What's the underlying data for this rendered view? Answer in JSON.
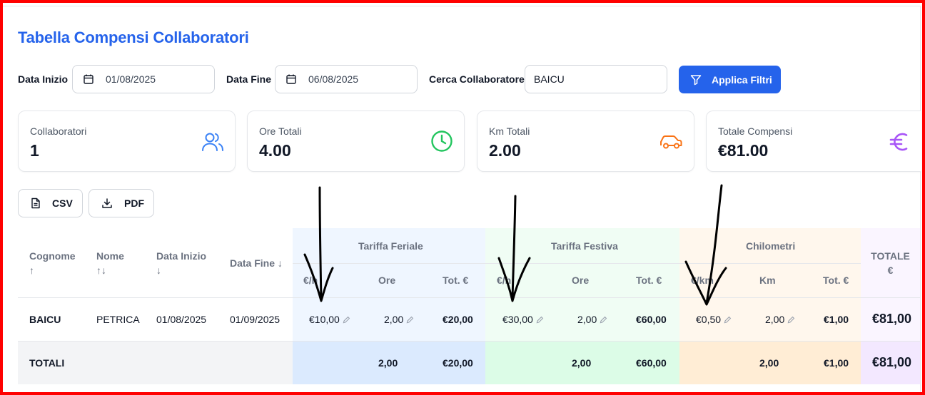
{
  "page": {
    "title": "Tabella Compensi Collaboratori"
  },
  "filters": {
    "start_label": "Data Inizio",
    "start_value": "01/08/2025",
    "end_label": "Data Fine",
    "end_value": "06/08/2025",
    "search_label": "Cerca Collaboratore",
    "search_value": "BAICU",
    "apply_label": "Applica Filtri"
  },
  "stats": [
    {
      "label": "Collaboratori",
      "value": "1",
      "icon": "users-icon",
      "color": "#3b82f6"
    },
    {
      "label": "Ore Totali",
      "value": "4.00",
      "icon": "clock-icon",
      "color": "#22c55e"
    },
    {
      "label": "Km Totali",
      "value": "2.00",
      "icon": "car-icon",
      "color": "#f97316"
    },
    {
      "label": "Totale Compensi",
      "value": "€81.00",
      "icon": "euro-icon",
      "color": "#a855f7"
    }
  ],
  "export": {
    "csv_label": "CSV",
    "pdf_label": "PDF"
  },
  "table": {
    "headers": {
      "cognome": "Cognome",
      "cognome_sort": "↑",
      "nome": "Nome",
      "nome_sort": "↑↓",
      "data_inizio": "Data Inizio",
      "data_inizio_sort": "↓",
      "data_fine": "Data Fine ↓",
      "group_feriale": "Tariffa Feriale",
      "group_festiva": "Tariffa Festiva",
      "group_km": "Chilometri",
      "totale": "TOTALE",
      "totale_unit": "€",
      "fer_rate": "€/h",
      "fer_ore": "Ore",
      "fer_tot": "Tot. €",
      "fes_rate": "€/h",
      "fes_ore": "Ore",
      "fes_tot": "Tot. €",
      "km_rate": "€/km",
      "km_km": "Km",
      "km_tot": "Tot. €"
    },
    "row": {
      "cognome": "BAICU",
      "nome": "PETRICA",
      "data_inizio": "01/08/2025",
      "data_fine": "01/09/2025",
      "fer_rate": "€10,00",
      "fer_ore": "2,00",
      "fer_tot": "€20,00",
      "fes_rate": "€30,00",
      "fes_ore": "2,00",
      "fes_tot": "€60,00",
      "km_rate": "€0,50",
      "km_km": "2,00",
      "km_tot": "€1,00",
      "totale": "€81,00"
    },
    "totals": {
      "label": "TOTALI",
      "fer_ore": "2,00",
      "fer_tot": "€20,00",
      "fes_ore": "2,00",
      "fes_tot": "€60,00",
      "km_km": "2,00",
      "km_tot": "€1,00",
      "totale": "€81,00"
    }
  },
  "colors": {
    "accent": "#2563eb",
    "feriale_bg": "#eff6ff",
    "festiva_bg": "#f0fdf4",
    "km_bg": "#fff7ed",
    "totale_bg": "#faf5ff"
  }
}
